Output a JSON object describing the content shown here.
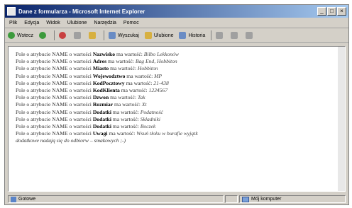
{
  "window": {
    "title": "Dane z formularza - Microsoft Internet Explorer"
  },
  "menu": [
    "Plik",
    "Edycja",
    "Widok",
    "Ulubione",
    "Narzędzia",
    "Pomoc"
  ],
  "toolbar": {
    "back": "Wstecz",
    "search": "Wyszukaj",
    "favorites": "Ulubione",
    "media": "Historia"
  },
  "content": {
    "prefix": "Pole o atrybucie NAME o wartości",
    "middle": "ma wartość:",
    "rows": [
      {
        "name": "Nazwisko",
        "value": "Bilbo Lekkonów"
      },
      {
        "name": "Adres",
        "value": "Bag End, Hobbiton"
      },
      {
        "name": "Miasto",
        "value": "Hobbiton"
      },
      {
        "name": "Wojewodztwo",
        "value": "MP"
      },
      {
        "name": "KodPocztowy",
        "value": "21-438"
      },
      {
        "name": "KodKlienta",
        "value": "1234567"
      },
      {
        "name": "Dzwon",
        "value": "Tak"
      },
      {
        "name": "Rozmiar",
        "value": "Xt"
      },
      {
        "name": "Dodatki",
        "value": "Podatność"
      },
      {
        "name": "Dodatki",
        "value": "Składniki"
      },
      {
        "name": "Dodatki",
        "value": "Boczek"
      },
      {
        "name": "Uwagi",
        "value": "Wsuń tłoku w burafie wyjątk"
      }
    ],
    "continuation": "dodatkowe nadają się do odbiorw – smakowych ;-)"
  },
  "status": {
    "left": "Gotowe",
    "right": "Mój komputer"
  }
}
